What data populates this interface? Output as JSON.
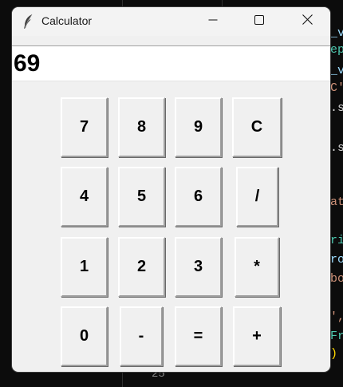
{
  "background_editor": {
    "right_fragments": [
      {
        "text": "_v",
        "color": "#9cdcfe"
      },
      {
        "text": "ep",
        "color": "#4ec9b0"
      },
      {
        "text": "_v",
        "color": "#9cdcfe"
      },
      {
        "text": "C'",
        "color": "#ce9178"
      },
      {
        "text": ".s",
        "color": "#d4d4d4"
      },
      {
        "text": ".s",
        "color": "#d4d4d4"
      },
      {
        "text": "at",
        "color": "#ce9178"
      },
      {
        "text": "ri",
        "color": "#4ec9b0"
      },
      {
        "text": "ro",
        "color": "#9cdcfe"
      },
      {
        "text": "bo",
        "color": "#ce9178"
      },
      {
        "text": "',",
        "color": "#ce9178"
      },
      {
        "text": "Fr",
        "color": "#4ec9b0"
      },
      {
        "text": ")",
        "color": "#ffd700"
      }
    ],
    "line_number": "25"
  },
  "window": {
    "title": "Calculator",
    "app_icon": "feather-icon",
    "controls": {
      "minimize_icon": "minimize-icon",
      "maximize_icon": "maximize-icon",
      "close_icon": "close-icon"
    }
  },
  "display": {
    "value": "69"
  },
  "keypad": {
    "rows": [
      [
        "7",
        "8",
        "9",
        "C"
      ],
      [
        "4",
        "5",
        "6",
        "/"
      ],
      [
        "1",
        "2",
        "3",
        "*"
      ],
      [
        "0",
        "-",
        "=",
        "+"
      ]
    ]
  }
}
